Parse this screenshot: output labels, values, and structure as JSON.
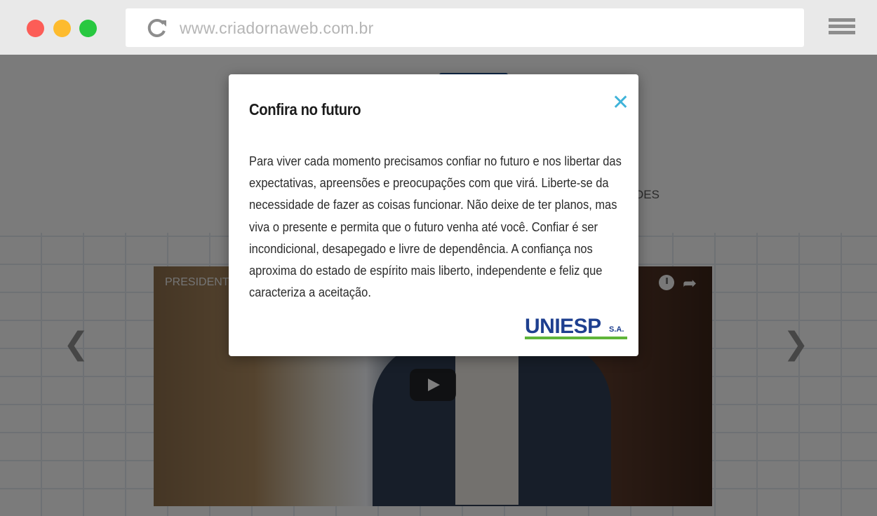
{
  "browser": {
    "url": "www.criadornaweb.com.br"
  },
  "page": {
    "peek_text": "DES",
    "video": {
      "title": "PRESIDENT"
    },
    "carousel": {
      "prev_label": "❮",
      "next_label": "❯"
    }
  },
  "modal": {
    "title": "Confira no futuro",
    "close_label": "✕",
    "body": "Para viver cada momento precisamos confiar no futuro e nos libertar das expectativas, apreensões e preocupações com que virá. Liberte-se da necessidade de fazer as coisas funcionar. Não deixe de ter planos, mas viva o presente e permita que o futuro venha até você. Confiar é ser incondicional, desapegado e livre de dependência. A confiança nos aproxima do estado de espírito mais liberto, independente e feliz que caracteriza a aceitação.",
    "brand": {
      "name": "UNIESP",
      "suffix": "S.A."
    }
  },
  "colors": {
    "accent_close": "#3fb3d9",
    "brand_blue": "#1e3f8f",
    "brand_green": "#5fb53a"
  }
}
